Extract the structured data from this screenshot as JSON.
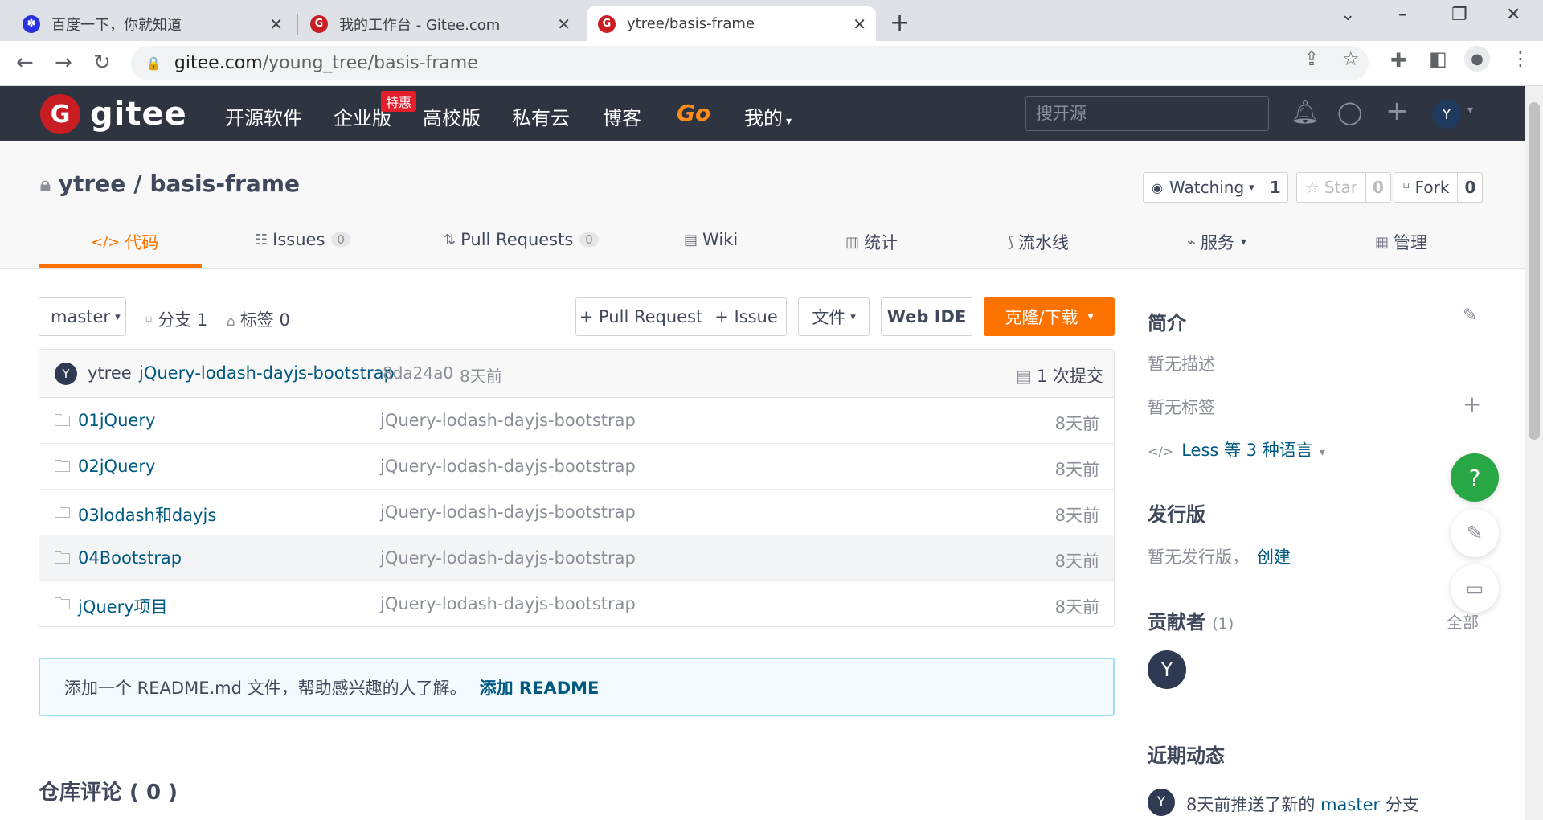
{
  "browser": {
    "tabs": [
      {
        "title": "百度一下，你就知道",
        "icon": "baidu-icon"
      },
      {
        "title": "我的工作台 - Gitee.com",
        "icon": "gitee-icon"
      },
      {
        "title": "ytree/basis-frame",
        "icon": "gitee-icon"
      }
    ],
    "url_host": "gitee.com",
    "url_path": "/young_tree/basis-frame"
  },
  "gitee": {
    "logo_text": "gitee",
    "logo_letter": "G",
    "nav": [
      "开源软件",
      "企业版",
      "高校版",
      "私有云",
      "博客",
      "Go",
      "我的"
    ],
    "badge": "特惠",
    "search_placeholder": "搜开源",
    "avatar_letter": "Y"
  },
  "repo": {
    "owner": "ytree",
    "name": "basis-frame",
    "title_sep": "/",
    "watch": {
      "label": "Watching",
      "count": "1"
    },
    "star": {
      "label": "Star",
      "count": "0"
    },
    "fork": {
      "label": "Fork",
      "count": "0"
    },
    "tabs": {
      "code": "代码",
      "issues": "Issues",
      "issues_count": "0",
      "pulls": "Pull Requests",
      "pulls_count": "0",
      "wiki": "Wiki",
      "stats": "统计",
      "pipeline": "流水线",
      "services": "服务",
      "manage": "管理"
    }
  },
  "branchbar": {
    "branch": "master",
    "branches": "分支 1",
    "tags": "标签 0",
    "pull_request": "+ Pull Request",
    "issue": "+ Issue",
    "file": "文件",
    "webide": "Web IDE",
    "clone": "克隆/下载"
  },
  "commit": {
    "avatar": "Y",
    "author": "ytree",
    "message": "jQuery-lodash-dayjs-bootstrap",
    "hash": "8da24a0",
    "time": "8天前",
    "count": "1 次提交"
  },
  "files": [
    {
      "name": "01jQuery",
      "message": "jQuery-lodash-dayjs-bootstrap",
      "time": "8天前"
    },
    {
      "name": "02jQuery",
      "message": "jQuery-lodash-dayjs-bootstrap",
      "time": "8天前"
    },
    {
      "name": "03lodash和dayjs",
      "message": "jQuery-lodash-dayjs-bootstrap",
      "time": "8天前"
    },
    {
      "name": "04Bootstrap",
      "message": "jQuery-lodash-dayjs-bootstrap",
      "time": "8天前"
    },
    {
      "name": "jQuery项目",
      "message": "jQuery-lodash-dayjs-bootstrap",
      "time": "8天前"
    }
  ],
  "readme": {
    "text": "添加一个 README.md 文件，帮助感兴趣的人了解。",
    "link": "添加 README"
  },
  "comments_title": "仓库评论 ( 0 )",
  "sidebar": {
    "intro_title": "简介",
    "no_desc": "暂无描述",
    "no_tags": "暂无标签",
    "lang": "Less 等 3 种语言",
    "release_title": "发行版",
    "no_release": "暂无发行版，",
    "create": "创建",
    "contrib_title": "贡献者",
    "contrib_count": "(1)",
    "all": "全部",
    "contrib_avatar": "Y",
    "activity_title": "近期动态",
    "activity_text": "8天前推送了新的",
    "activity_branch": "master",
    "activity_suffix": "分支"
  }
}
